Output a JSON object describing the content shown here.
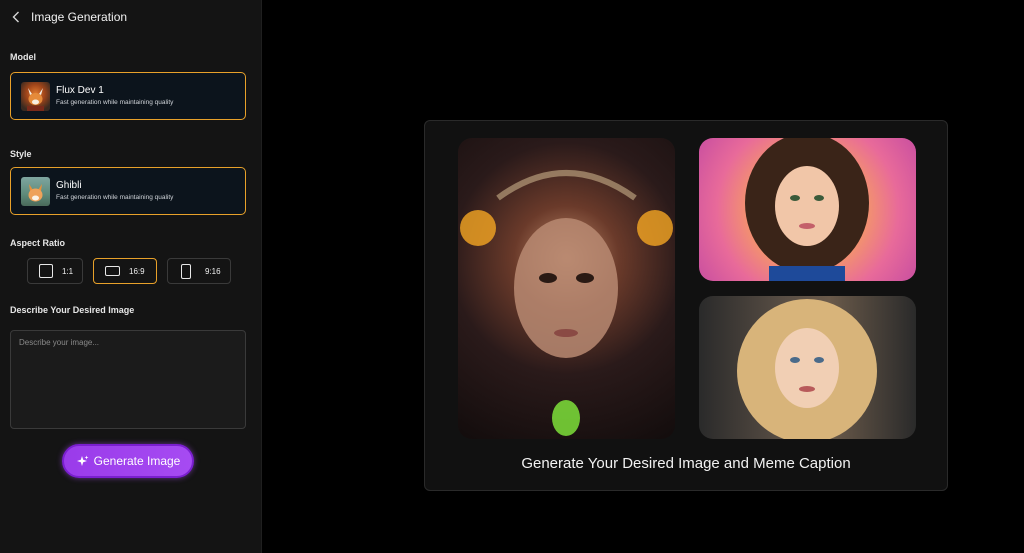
{
  "header": {
    "title": "Image Generation",
    "back_icon": "chevron-left-icon"
  },
  "model": {
    "label": "Model",
    "name": "Flux Dev 1",
    "description": "Fast generation while maintaining quality",
    "selected": true
  },
  "style": {
    "label": "Style",
    "name": "Ghibli",
    "description": "Fast generation while maintaining quality",
    "selected": true
  },
  "aspect_ratio": {
    "label": "Aspect Ratio",
    "options": [
      "1:1",
      "16:9",
      "9:16"
    ],
    "selected": "16:9"
  },
  "prompt": {
    "label": "Describe Your Desired Image",
    "placeholder": "Describe your image...",
    "value": ""
  },
  "generate": {
    "label": "Generate Image",
    "icon": "sparkle-icon"
  },
  "preview": {
    "caption": "Generate Your Desired Image and Meme Caption"
  },
  "colors": {
    "accent": "#e8a12a",
    "button": "#a64bf2",
    "background": "#000000",
    "sidebar": "#141414"
  }
}
